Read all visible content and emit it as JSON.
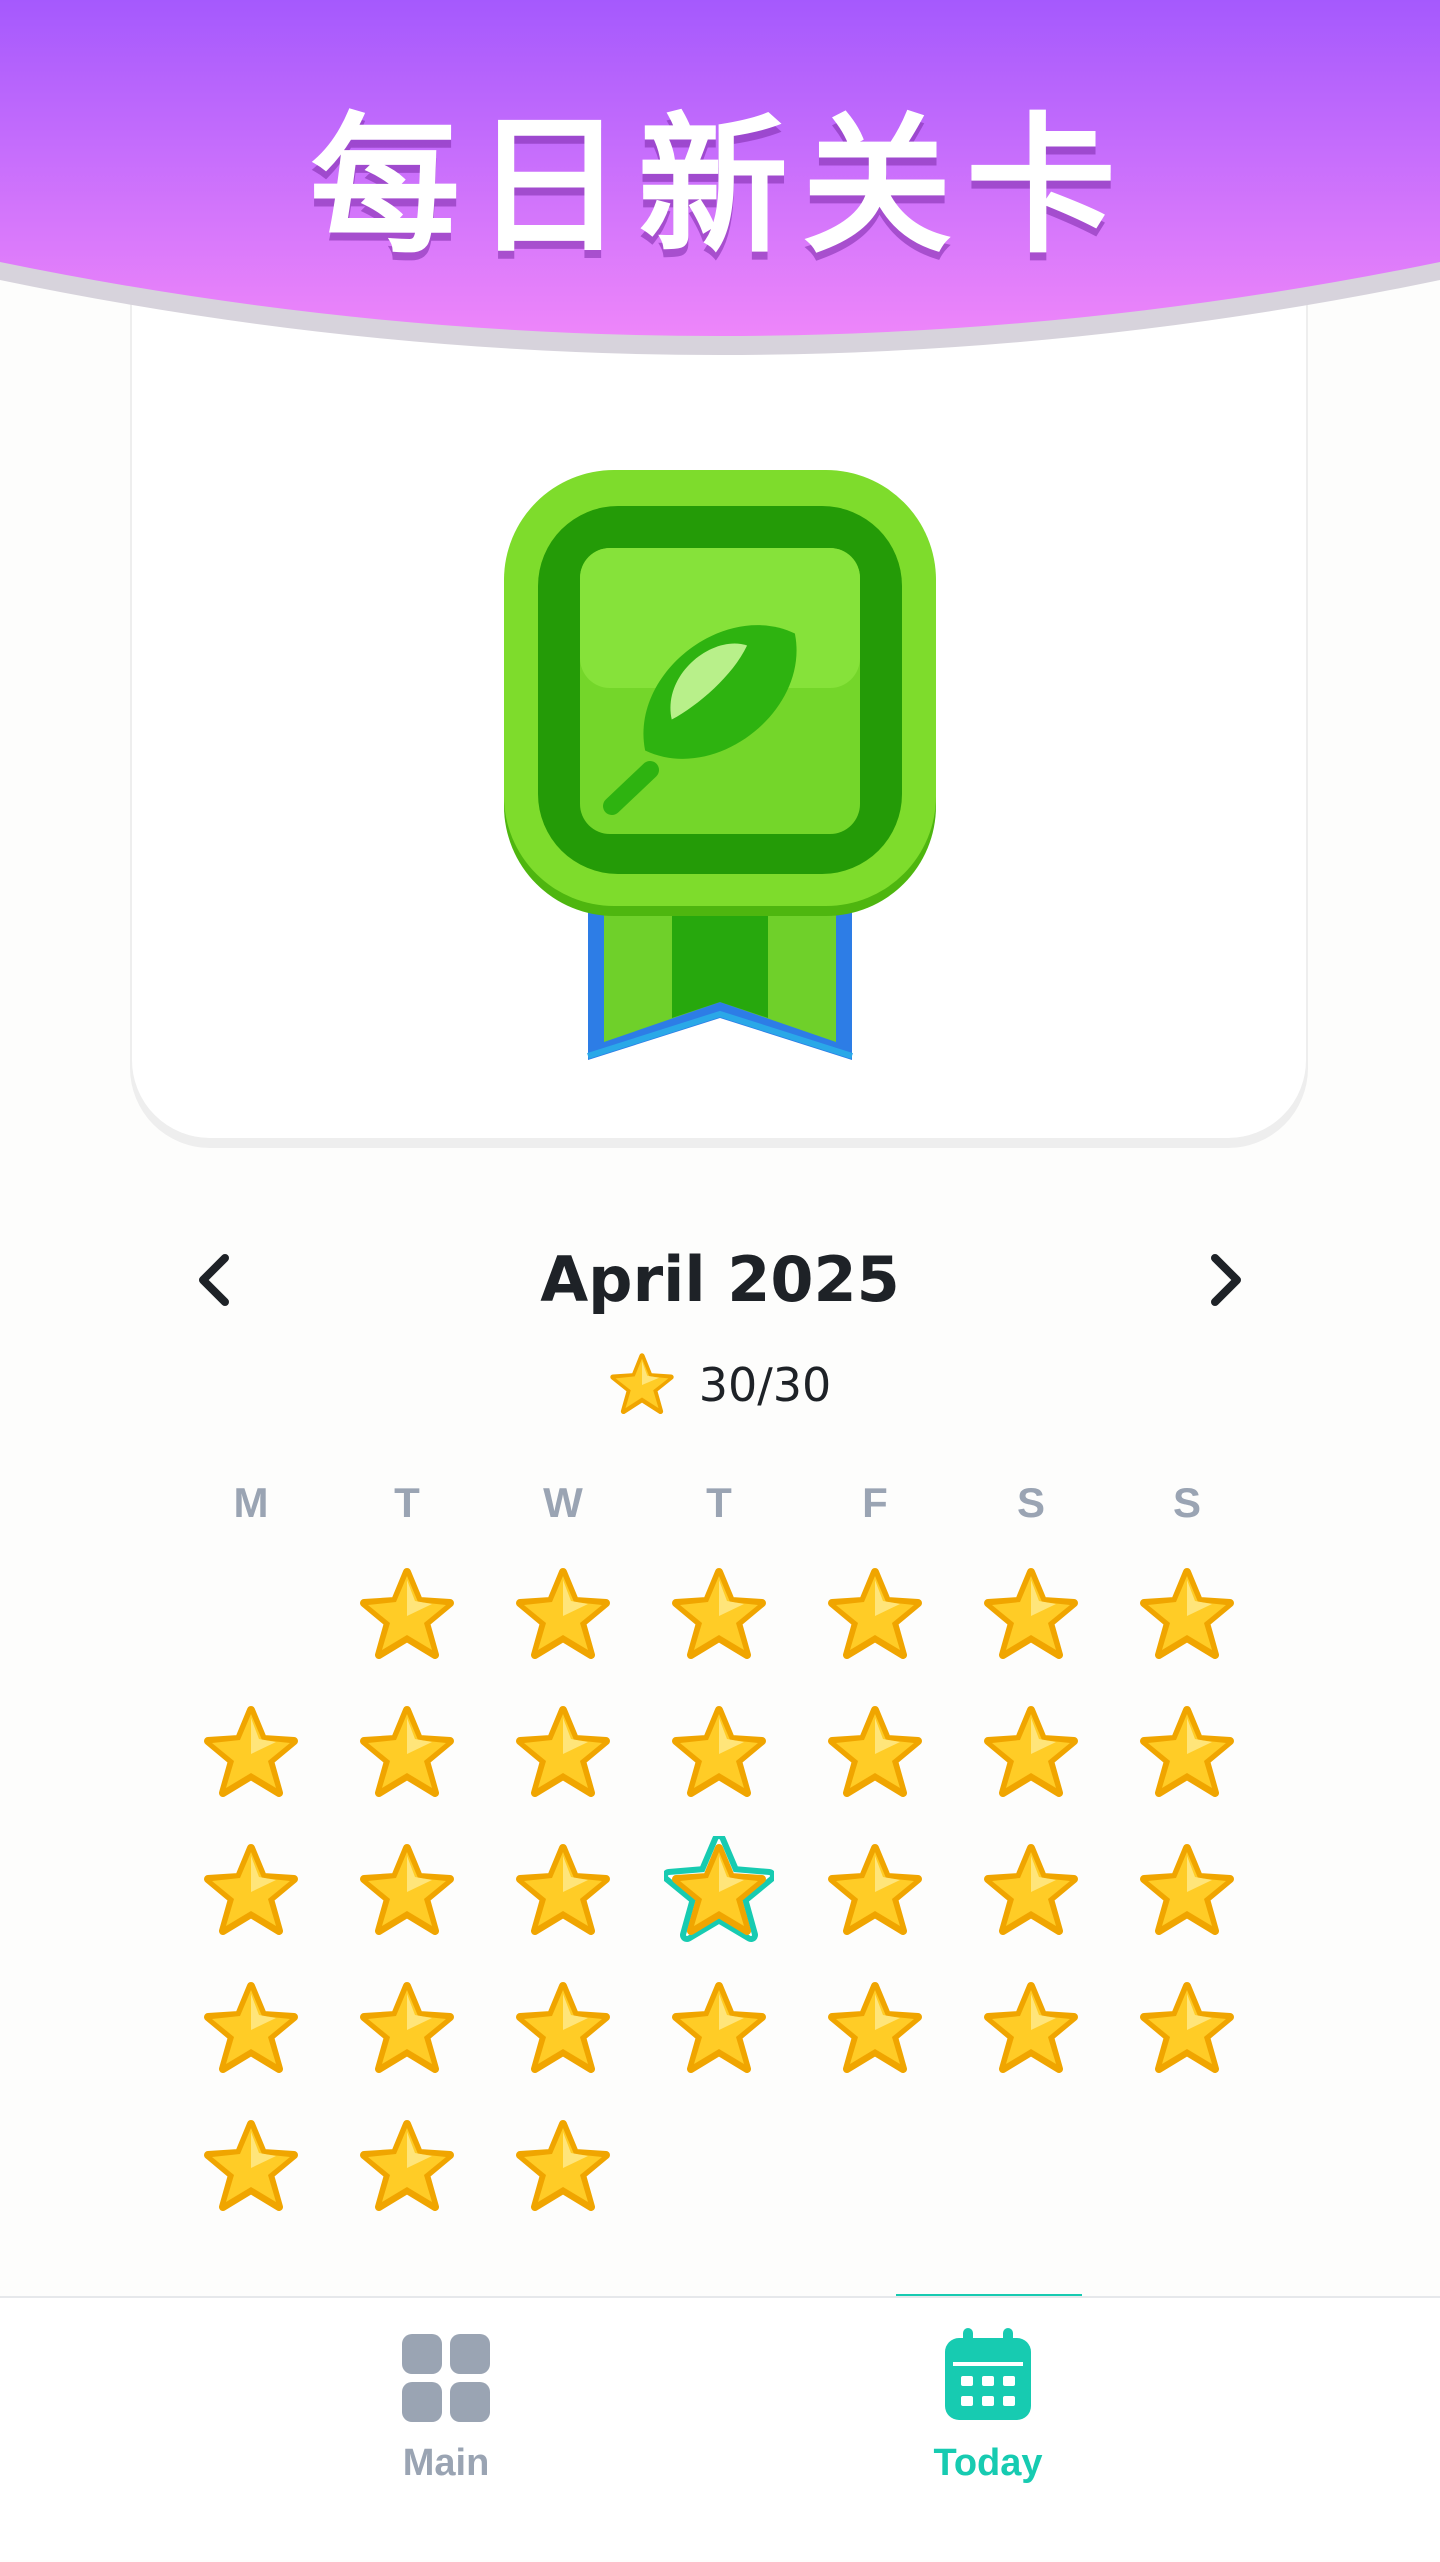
{
  "banner": {
    "title": "每日新关卡"
  },
  "badge": {
    "icon": "leaf-medal-icon"
  },
  "calendar": {
    "month_title": "April 2025",
    "progress": "30/30",
    "weekdays": [
      "M",
      "T",
      "W",
      "T",
      "F",
      "S",
      "S"
    ],
    "days_completed": 30,
    "days_in_month": 30,
    "first_weekday_offset": 1,
    "current_day": 17
  },
  "nav": {
    "main_label": "Main",
    "today_label": "Today",
    "active": "Today"
  },
  "colors": {
    "banner_top": "#a559fd",
    "banner_bottom": "#ee86fa",
    "accent": "#17cbb1",
    "star": "#ffc21a",
    "badge_green": "#5ec516",
    "inactive": "#9aa4b3"
  }
}
